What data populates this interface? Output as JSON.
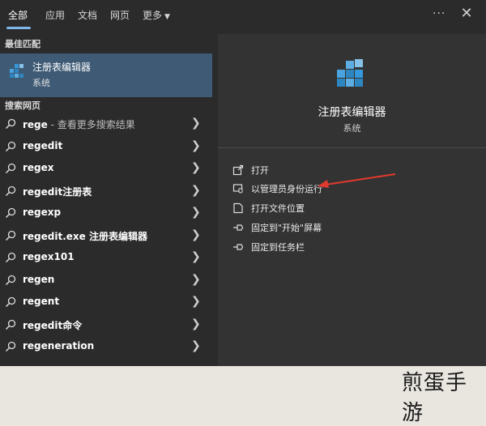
{
  "tabs": [
    {
      "label": "全部",
      "active": true
    },
    {
      "label": "应用"
    },
    {
      "label": "文档"
    },
    {
      "label": "网页"
    },
    {
      "label": "更多"
    }
  ],
  "best_match": {
    "heading": "最佳匹配",
    "title": "注册表编辑器",
    "subtitle": "系统"
  },
  "web_search": {
    "heading": "搜索网页",
    "items": [
      {
        "bold": "rege",
        "rest": " - 查看更多搜索结果"
      },
      {
        "bold": "regedit",
        "rest": ""
      },
      {
        "bold": "regex",
        "rest": ""
      },
      {
        "bold": "regedit注册表",
        "rest": ""
      },
      {
        "bold": "regexp",
        "rest": ""
      },
      {
        "bold": "regedit.exe 注册表编辑器",
        "rest": ""
      },
      {
        "bold": "regex101",
        "rest": ""
      },
      {
        "bold": "regen",
        "rest": ""
      },
      {
        "bold": "regent",
        "rest": ""
      },
      {
        "bold": "regedit命令",
        "rest": ""
      },
      {
        "bold": "regeneration",
        "rest": ""
      }
    ]
  },
  "detail": {
    "title": "注册表编辑器",
    "subtitle": "系统",
    "actions": [
      {
        "label": "打开",
        "icon": "open-icon"
      },
      {
        "label": "以管理员身份运行",
        "icon": "shield-icon"
      },
      {
        "label": "打开文件位置",
        "icon": "folder-icon"
      },
      {
        "label": "固定到\"开始\"屏幕",
        "icon": "pin-icon"
      },
      {
        "label": "固定到任务栏",
        "icon": "pin-icon"
      }
    ]
  },
  "watermark": "煎蛋手游",
  "colors": {
    "background": "#2b2b2b",
    "highlight": "#3e5a75",
    "accent": "#7fb8e8",
    "annotation_arrow": "#e03a2f"
  }
}
